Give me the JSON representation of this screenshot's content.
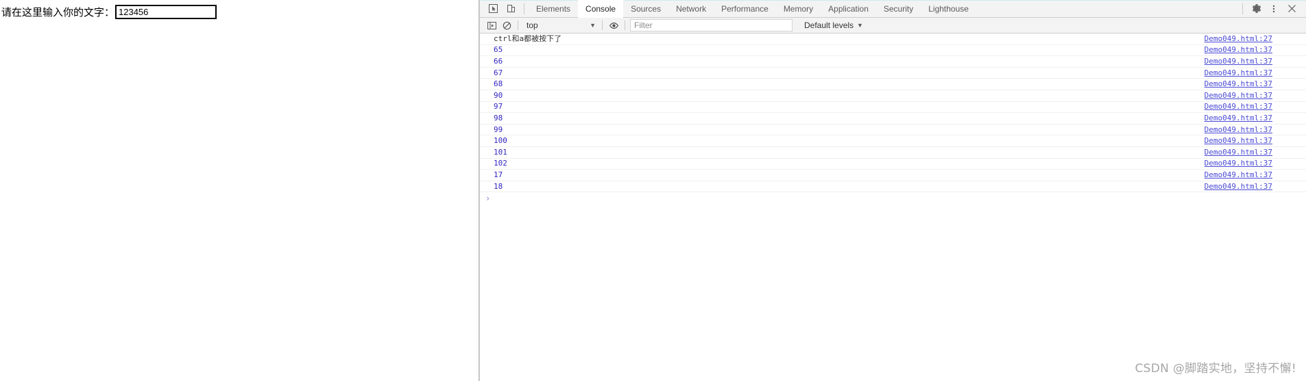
{
  "page": {
    "form_label": "请在这里输入你的文字：",
    "input_value": "123456",
    "input_placeholder": ""
  },
  "devtools": {
    "toolbar": {
      "inspect_icon": "inspect-cursor-icon",
      "device_icon": "device-toolbar-icon",
      "settings_icon": "gear-icon",
      "more_icon": "kebab-menu-icon",
      "close_icon": "close-icon",
      "tabs": [
        {
          "label": "Elements",
          "active": false
        },
        {
          "label": "Console",
          "active": true
        },
        {
          "label": "Sources",
          "active": false
        },
        {
          "label": "Network",
          "active": false
        },
        {
          "label": "Performance",
          "active": false
        },
        {
          "label": "Memory",
          "active": false
        },
        {
          "label": "Application",
          "active": false
        },
        {
          "label": "Security",
          "active": false
        },
        {
          "label": "Lighthouse",
          "active": false
        }
      ]
    },
    "filterbar": {
      "sidebar_icon": "console-sidebar-icon",
      "clear_icon": "clear-console-icon",
      "eye_icon": "live-expression-eye-icon",
      "context_value": "top",
      "context_caret": "▼",
      "filter_placeholder": "Filter",
      "filter_value": "",
      "levels_label": "Default levels",
      "levels_caret": "▼"
    },
    "console": {
      "messages": [
        {
          "text": "ctrl和a都被按下了",
          "type": "text",
          "source": "Demo049.html:27"
        },
        {
          "text": "65",
          "type": "number",
          "source": "Demo049.html:37"
        },
        {
          "text": "66",
          "type": "number",
          "source": "Demo049.html:37"
        },
        {
          "text": "67",
          "type": "number",
          "source": "Demo049.html:37"
        },
        {
          "text": "68",
          "type": "number",
          "source": "Demo049.html:37"
        },
        {
          "text": "90",
          "type": "number",
          "source": "Demo049.html:37"
        },
        {
          "text": "97",
          "type": "number",
          "source": "Demo049.html:37"
        },
        {
          "text": "98",
          "type": "number",
          "source": "Demo049.html:37"
        },
        {
          "text": "99",
          "type": "number",
          "source": "Demo049.html:37"
        },
        {
          "text": "100",
          "type": "number",
          "source": "Demo049.html:37"
        },
        {
          "text": "101",
          "type": "number",
          "source": "Demo049.html:37"
        },
        {
          "text": "102",
          "type": "number",
          "source": "Demo049.html:37"
        },
        {
          "text": "17",
          "type": "number",
          "source": "Demo049.html:37"
        },
        {
          "text": "18",
          "type": "number",
          "source": "Demo049.html:37"
        }
      ],
      "prompt_caret": "›",
      "prompt_value": ""
    }
  },
  "watermark": "CSDN @脚踏实地，坚持不懈!",
  "colors": {
    "toolbar_bg": "#f3f3f3",
    "number_blue": "#2f24c0",
    "link_blue": "#4a4ad6",
    "accent_top": "#cfe9f5"
  }
}
